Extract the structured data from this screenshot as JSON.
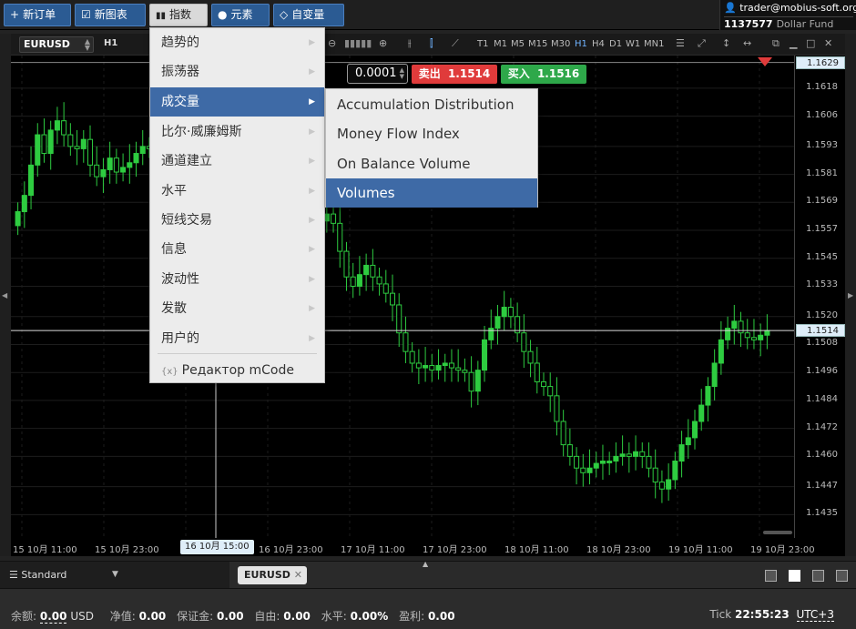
{
  "toolbar": {
    "new_order": "新订单",
    "new_chart": "新图表",
    "indicators": "指数",
    "elements": "元素",
    "variables": "自变量"
  },
  "account": {
    "email": "trader@mobius-soft.org",
    "number": "1137577",
    "fund": "Dollar Fund"
  },
  "chart_toolbar": {
    "symbol": "EURUSD",
    "timeframe": "H1",
    "timeframes": [
      "T1",
      "M1",
      "M5",
      "M15",
      "M30",
      "H1",
      "H4",
      "D1",
      "W1",
      "MN1"
    ],
    "active_timeframe": "H1"
  },
  "trade": {
    "lot": "0.0001",
    "sell_label": "卖出",
    "sell_price": "1.1514",
    "buy_label": "买入",
    "buy_price": "1.1516",
    "sell_color": "#e03b3b",
    "buy_color": "#2ea84a"
  },
  "menu": {
    "items": [
      {
        "label": "趋势的"
      },
      {
        "label": "振荡器"
      },
      {
        "label": "成交量"
      },
      {
        "label": "比尔·威廉姆斯"
      },
      {
        "label": "通道建立"
      },
      {
        "label": "水平"
      },
      {
        "label": "短线交易"
      },
      {
        "label": "信息"
      },
      {
        "label": "波动性"
      },
      {
        "label": "发散"
      },
      {
        "label": "用户的"
      }
    ],
    "selected": "成交量",
    "mcode_label": "Редактор mCode",
    "mcode_icon": "{x}"
  },
  "submenu": {
    "items": [
      {
        "label": "Accumulation Distribution"
      },
      {
        "label": "Money Flow Index"
      },
      {
        "label": "On Balance Volume"
      },
      {
        "label": "Volumes"
      }
    ],
    "selected": "Volumes"
  },
  "chart_data": {
    "type": "candlestick",
    "symbol": "EURUSD",
    "timeframe": "H1",
    "ylim": [
      1.1425,
      1.1632
    ],
    "y_ticks": [
      "1.1618",
      "1.1606",
      "1.1593",
      "1.1581",
      "1.1569",
      "1.1557",
      "1.1545",
      "1.1533",
      "1.1520",
      "1.1508",
      "1.1496",
      "1.1484",
      "1.1472",
      "1.1460",
      "1.1447",
      "1.1435"
    ],
    "top_flag": "1.1629",
    "price_flag": "1.1514",
    "x_ticks": [
      "15 10月 11:00",
      "15 10月 23:00",
      "16 10月 15:00",
      "16 10月 23:00",
      "17 10月 11:00",
      "17 10月 23:00",
      "18 10月 11:00",
      "18 10月 23:00",
      "19 10月 11:00",
      "19 10月 23:00"
    ],
    "crosshair_label": "16 10月 15:00",
    "candle_up_color": "#2ecc40",
    "candle_down_color": "#2ecc40",
    "grid": true,
    "close_series": [
      1.1565,
      1.1572,
      1.1585,
      1.1598,
      1.159,
      1.16,
      1.1604,
      1.1598,
      1.1593,
      1.1592,
      1.1596,
      1.1585,
      1.158,
      1.1583,
      1.1588,
      1.1582,
      1.1584,
      1.1586,
      1.159,
      1.1593,
      1.1592,
      1.1585,
      1.158,
      1.1575,
      1.157,
      1.1568,
      1.1572,
      1.158,
      1.159,
      1.1598,
      1.16,
      1.1596,
      1.159,
      1.1582,
      1.1575,
      1.157,
      1.1565,
      1.1562,
      1.156,
      1.1558,
      1.1562,
      1.1566,
      1.1564,
      1.1558,
      1.1552,
      1.1556,
      1.1561,
      1.1564,
      1.156,
      1.1548,
      1.1537,
      1.1533,
      1.1538,
      1.1542,
      1.1537,
      1.1534,
      1.153,
      1.1525,
      1.1513,
      1.1505,
      1.15,
      1.1498,
      1.1499,
      1.1497,
      1.1499,
      1.15,
      1.1498,
      1.1497,
      1.1496,
      1.1488,
      1.1497,
      1.151,
      1.1515,
      1.152,
      1.1524,
      1.152,
      1.1513,
      1.1505,
      1.15,
      1.1492,
      1.149,
      1.1486,
      1.1475,
      1.1465,
      1.146,
      1.1455,
      1.1453,
      1.1455,
      1.1457,
      1.1458,
      1.1458,
      1.146,
      1.1461,
      1.146,
      1.1462,
      1.146,
      1.1455,
      1.1449,
      1.1446,
      1.145,
      1.1458,
      1.1465,
      1.1468,
      1.1475,
      1.1482,
      1.149,
      1.15,
      1.151,
      1.1515,
      1.1518,
      1.1513,
      1.1511,
      1.151,
      1.1512,
      1.1514
    ]
  },
  "bottom": {
    "layout_label": "Standard",
    "tab_label": "EURUSD"
  },
  "status": {
    "balance_label": "余额:",
    "balance": "0.00",
    "currency": "USD",
    "equity_label": "净值:",
    "equity": "0.00",
    "margin_label": "保证金:",
    "margin": "0.00",
    "free_label": "自由:",
    "free": "0.00",
    "level_label": "水平:",
    "level": "0.00%",
    "profit_label": "盈利:",
    "profit": "0.00",
    "tick_label": "Tick",
    "time": "22:55:23",
    "timezone": "UTC+3"
  }
}
